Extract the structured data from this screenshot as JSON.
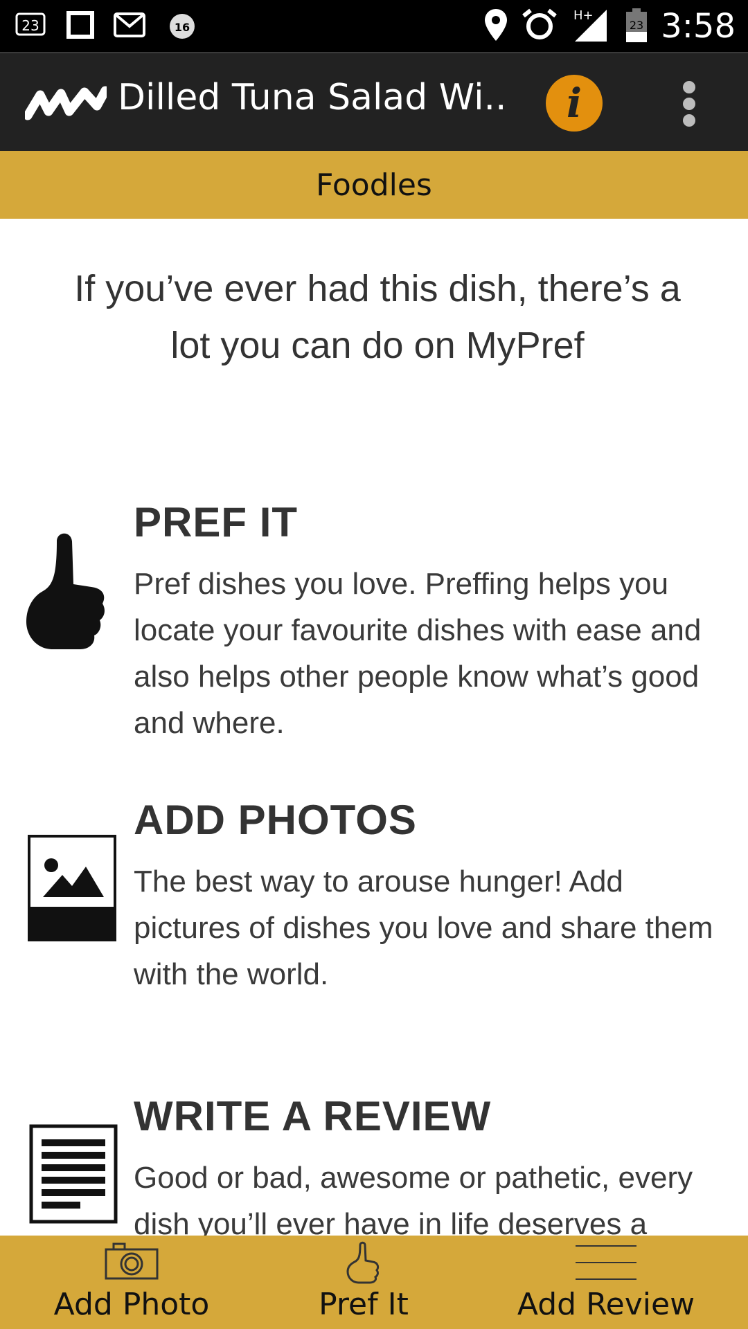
{
  "status_bar": {
    "notification_badge": "23",
    "clock_alarm_badge": "16",
    "network_label": "H+",
    "battery_level": "23",
    "time": "3:58"
  },
  "action_bar": {
    "title": "Dilled Tuna Salad Wi...",
    "info_label": "i",
    "icons": [
      "app-logo",
      "info-icon",
      "overflow-menu-icon"
    ]
  },
  "banner": {
    "label": "Foodles"
  },
  "intro": {
    "text": "If you’ve ever had this dish, there’s a lot you can do on MyPref"
  },
  "features": [
    {
      "icon": "thumbs-up-icon",
      "title": "PREF IT",
      "text": "Pref dishes you love. Preffing helps you locate your favourite dishes with ease and also helps other people know what’s good and where."
    },
    {
      "icon": "photo-icon",
      "title": "ADD PHOTOS",
      "text": "The best way to arouse hunger! Add pictures of dishes you love and share them with the world."
    },
    {
      "icon": "review-document-icon",
      "title": "WRITE A REVIEW",
      "text": "Good or bad, awesome or pathetic, every dish you’ll ever have in life deserves a comment,"
    }
  ],
  "bottom_nav": {
    "items": [
      {
        "icon": "camera-icon",
        "label": "Add Photo"
      },
      {
        "icon": "thumbs-up-outline-icon",
        "label": "Pref It"
      },
      {
        "icon": "lines-icon",
        "label": "Add Review"
      }
    ]
  },
  "colors": {
    "accent_gold": "#d5a83a",
    "info_orange": "#e3900e",
    "action_bar_bg": "#222222",
    "status_bar_bg": "#000000"
  }
}
